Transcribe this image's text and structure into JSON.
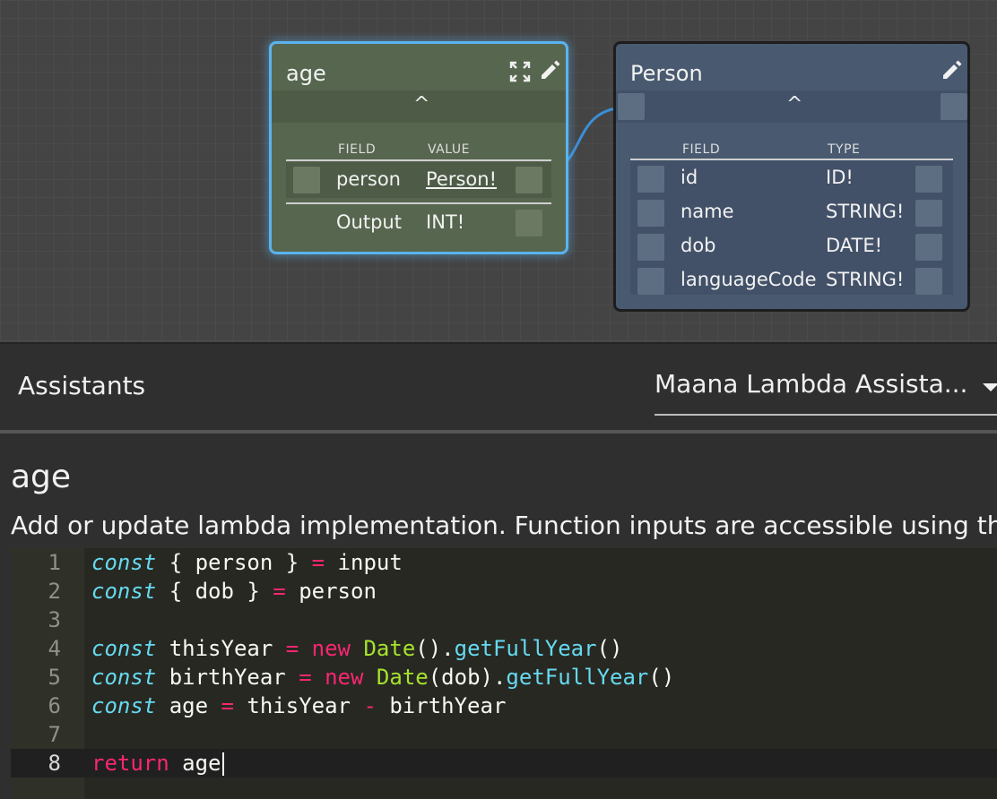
{
  "canvas": {
    "age_node": {
      "title": "age",
      "collapse_icon": "chevron-up-icon",
      "columns": [
        "FIELD",
        "VALUE"
      ],
      "rows": [
        {
          "field": "person",
          "value": "Person!",
          "linked": true
        },
        {
          "field": "Output",
          "value": "INT!",
          "linked": false
        }
      ],
      "accent_color": "#5ab3ee"
    },
    "person_node": {
      "title": "Person",
      "columns": [
        "FIELD",
        "TYPE"
      ],
      "rows": [
        {
          "field": "id",
          "type": "ID!"
        },
        {
          "field": "name",
          "type": "STRING!"
        },
        {
          "field": "dob",
          "type": "DATE!"
        },
        {
          "field": "languageCode",
          "type": "STRING!"
        }
      ]
    },
    "chevron_glyph": "^"
  },
  "assistants": {
    "label": "Assistants",
    "selected": "Maana Lambda Assista..."
  },
  "lambda": {
    "title": "age",
    "description": "Add or update lambda implementation. Function inputs are accessible using the '",
    "line_numbers": [
      "1",
      "2",
      "3",
      "4",
      "5",
      "6",
      "7",
      "8"
    ],
    "code": [
      "const { person } = input",
      "const { dob } = person",
      "",
      "const thisYear = new Date().getFullYear()",
      "const birthYear = new Date(dob).getFullYear()",
      "const age = thisYear - birthYear",
      "",
      "return age"
    ],
    "active_line": 8
  }
}
